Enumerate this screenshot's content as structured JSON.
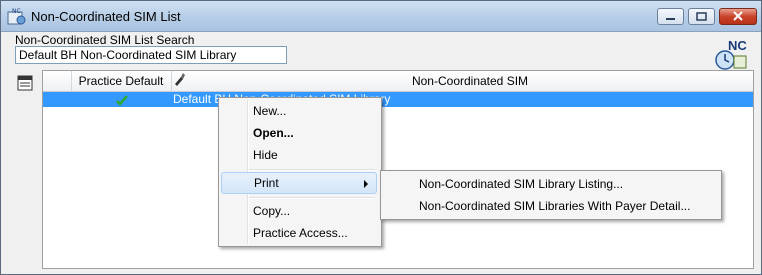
{
  "window": {
    "title": "Non-Coordinated SIM List",
    "app_icon": "nc-app-icon"
  },
  "search": {
    "label": "Non-Coordinated SIM List Search",
    "value": "Default BH Non-Coordinated SIM Library"
  },
  "badge": {
    "text": "NC"
  },
  "grid": {
    "columns": [
      "Practice Default",
      "",
      "Non-Coordinated SIM"
    ],
    "rows": [
      {
        "practice_default": true,
        "name": "Default BH Non-Coordinated SIM Library"
      }
    ]
  },
  "context_menu": {
    "items": [
      "New...",
      "Open...",
      "Hide",
      "Print",
      "Copy...",
      "Practice Access..."
    ]
  },
  "print_submenu": {
    "items": [
      "Non-Coordinated SIM Library Listing...",
      "Non-Coordinated SIM Libraries With Payer Detail..."
    ]
  },
  "colors": {
    "selection": "#3399ff",
    "titlebar": "#b9cfe8",
    "close_button": "#c9432a"
  }
}
